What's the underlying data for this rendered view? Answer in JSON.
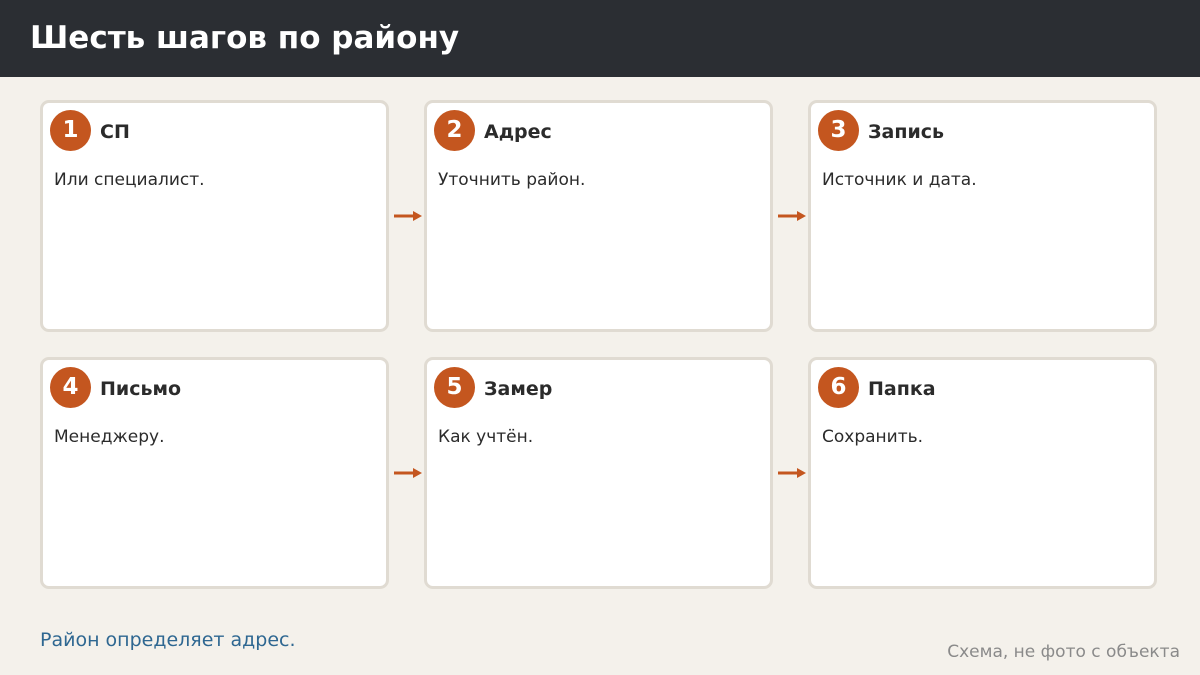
{
  "header": {
    "title": "Шесть шагов по району"
  },
  "steps": [
    {
      "number": "1",
      "title": "СП",
      "description": "Или специалист."
    },
    {
      "number": "2",
      "title": "Адрес",
      "description": "Уточнить район."
    },
    {
      "number": "3",
      "title": "Запись",
      "description": "Источник и дата."
    },
    {
      "number": "4",
      "title": "Письмо",
      "description": "Менеджеру."
    },
    {
      "number": "5",
      "title": "Замер",
      "description": "Как учтён."
    },
    {
      "number": "6",
      "title": "Папка",
      "description": "Сохранить."
    }
  ],
  "footer": {
    "note": "Район определяет адрес.",
    "caption": "Схема, не фото с объекта"
  },
  "colors": {
    "header_bg": "#2b2e33",
    "accent": "#c4561f",
    "note_text": "#2e6791",
    "page_bg": "#f4f1eb"
  },
  "icons": {
    "connector": "arrow-right-icon"
  }
}
